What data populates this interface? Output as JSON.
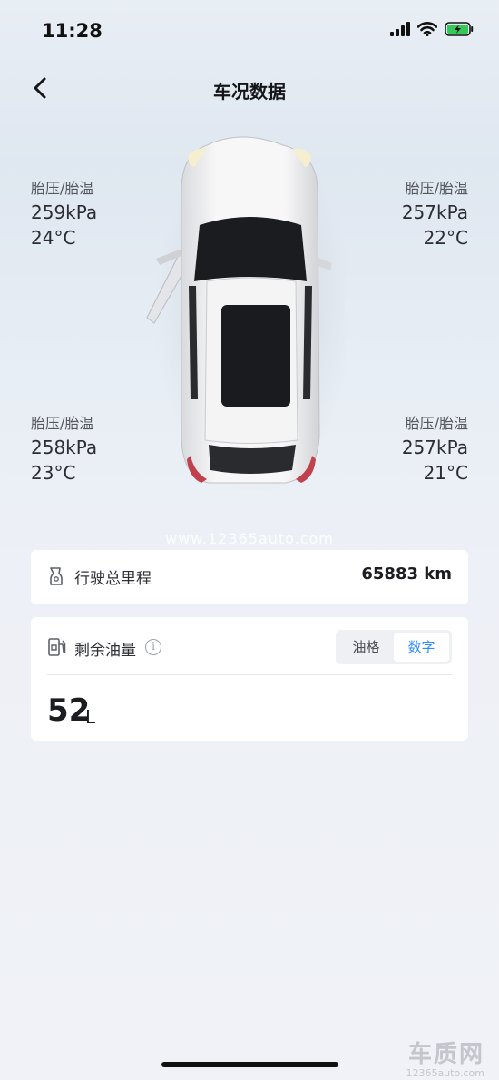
{
  "status_bar": {
    "time": "11:28"
  },
  "nav": {
    "title": "车况数据"
  },
  "tires": {
    "front_left": {
      "label": "胎压/胎温",
      "pressure": "259kPa",
      "temp": "24°C"
    },
    "front_right": {
      "label": "胎压/胎温",
      "pressure": "257kPa",
      "temp": "22°C"
    },
    "rear_left": {
      "label": "胎压/胎温",
      "pressure": "258kPa",
      "temp": "23°C"
    },
    "rear_right": {
      "label": "胎压/胎温",
      "pressure": "257kPa",
      "temp": "21°C"
    }
  },
  "watermark": "www.12365auto.com",
  "mileage": {
    "label": "行驶总里程",
    "value": "65883 km",
    "icon": "odometer-icon"
  },
  "fuel": {
    "label": "剩余油量",
    "icon": "fuel-pump-icon",
    "info_icon": "info-icon",
    "segments": [
      "油格",
      "数字"
    ],
    "selected_segment": "数字",
    "value": "52",
    "unit": "L"
  },
  "corner_logo": {
    "big": "车质网",
    "small": "12365auto.com"
  },
  "colors": {
    "accent": "#2d8cff",
    "background": "#edf0f6",
    "card": "#ffffff"
  }
}
